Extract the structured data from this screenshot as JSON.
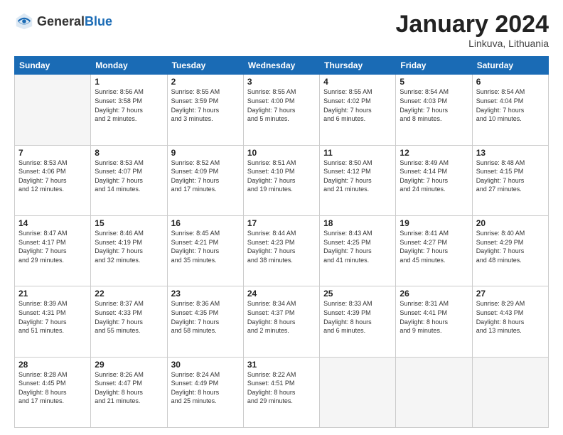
{
  "header": {
    "logo_general": "General",
    "logo_blue": "Blue",
    "month_title": "January 2024",
    "subtitle": "Linkuva, Lithuania"
  },
  "days_of_week": [
    "Sunday",
    "Monday",
    "Tuesday",
    "Wednesday",
    "Thursday",
    "Friday",
    "Saturday"
  ],
  "weeks": [
    [
      {
        "day": "",
        "info": ""
      },
      {
        "day": "1",
        "info": "Sunrise: 8:56 AM\nSunset: 3:58 PM\nDaylight: 7 hours\nand 2 minutes."
      },
      {
        "day": "2",
        "info": "Sunrise: 8:55 AM\nSunset: 3:59 PM\nDaylight: 7 hours\nand 3 minutes."
      },
      {
        "day": "3",
        "info": "Sunrise: 8:55 AM\nSunset: 4:00 PM\nDaylight: 7 hours\nand 5 minutes."
      },
      {
        "day": "4",
        "info": "Sunrise: 8:55 AM\nSunset: 4:02 PM\nDaylight: 7 hours\nand 6 minutes."
      },
      {
        "day": "5",
        "info": "Sunrise: 8:54 AM\nSunset: 4:03 PM\nDaylight: 7 hours\nand 8 minutes."
      },
      {
        "day": "6",
        "info": "Sunrise: 8:54 AM\nSunset: 4:04 PM\nDaylight: 7 hours\nand 10 minutes."
      }
    ],
    [
      {
        "day": "7",
        "info": "Sunrise: 8:53 AM\nSunset: 4:06 PM\nDaylight: 7 hours\nand 12 minutes."
      },
      {
        "day": "8",
        "info": "Sunrise: 8:53 AM\nSunset: 4:07 PM\nDaylight: 7 hours\nand 14 minutes."
      },
      {
        "day": "9",
        "info": "Sunrise: 8:52 AM\nSunset: 4:09 PM\nDaylight: 7 hours\nand 17 minutes."
      },
      {
        "day": "10",
        "info": "Sunrise: 8:51 AM\nSunset: 4:10 PM\nDaylight: 7 hours\nand 19 minutes."
      },
      {
        "day": "11",
        "info": "Sunrise: 8:50 AM\nSunset: 4:12 PM\nDaylight: 7 hours\nand 21 minutes."
      },
      {
        "day": "12",
        "info": "Sunrise: 8:49 AM\nSunset: 4:14 PM\nDaylight: 7 hours\nand 24 minutes."
      },
      {
        "day": "13",
        "info": "Sunrise: 8:48 AM\nSunset: 4:15 PM\nDaylight: 7 hours\nand 27 minutes."
      }
    ],
    [
      {
        "day": "14",
        "info": "Sunrise: 8:47 AM\nSunset: 4:17 PM\nDaylight: 7 hours\nand 29 minutes."
      },
      {
        "day": "15",
        "info": "Sunrise: 8:46 AM\nSunset: 4:19 PM\nDaylight: 7 hours\nand 32 minutes."
      },
      {
        "day": "16",
        "info": "Sunrise: 8:45 AM\nSunset: 4:21 PM\nDaylight: 7 hours\nand 35 minutes."
      },
      {
        "day": "17",
        "info": "Sunrise: 8:44 AM\nSunset: 4:23 PM\nDaylight: 7 hours\nand 38 minutes."
      },
      {
        "day": "18",
        "info": "Sunrise: 8:43 AM\nSunset: 4:25 PM\nDaylight: 7 hours\nand 41 minutes."
      },
      {
        "day": "19",
        "info": "Sunrise: 8:41 AM\nSunset: 4:27 PM\nDaylight: 7 hours\nand 45 minutes."
      },
      {
        "day": "20",
        "info": "Sunrise: 8:40 AM\nSunset: 4:29 PM\nDaylight: 7 hours\nand 48 minutes."
      }
    ],
    [
      {
        "day": "21",
        "info": "Sunrise: 8:39 AM\nSunset: 4:31 PM\nDaylight: 7 hours\nand 51 minutes."
      },
      {
        "day": "22",
        "info": "Sunrise: 8:37 AM\nSunset: 4:33 PM\nDaylight: 7 hours\nand 55 minutes."
      },
      {
        "day": "23",
        "info": "Sunrise: 8:36 AM\nSunset: 4:35 PM\nDaylight: 7 hours\nand 58 minutes."
      },
      {
        "day": "24",
        "info": "Sunrise: 8:34 AM\nSunset: 4:37 PM\nDaylight: 8 hours\nand 2 minutes."
      },
      {
        "day": "25",
        "info": "Sunrise: 8:33 AM\nSunset: 4:39 PM\nDaylight: 8 hours\nand 6 minutes."
      },
      {
        "day": "26",
        "info": "Sunrise: 8:31 AM\nSunset: 4:41 PM\nDaylight: 8 hours\nand 9 minutes."
      },
      {
        "day": "27",
        "info": "Sunrise: 8:29 AM\nSunset: 4:43 PM\nDaylight: 8 hours\nand 13 minutes."
      }
    ],
    [
      {
        "day": "28",
        "info": "Sunrise: 8:28 AM\nSunset: 4:45 PM\nDaylight: 8 hours\nand 17 minutes."
      },
      {
        "day": "29",
        "info": "Sunrise: 8:26 AM\nSunset: 4:47 PM\nDaylight: 8 hours\nand 21 minutes."
      },
      {
        "day": "30",
        "info": "Sunrise: 8:24 AM\nSunset: 4:49 PM\nDaylight: 8 hours\nand 25 minutes."
      },
      {
        "day": "31",
        "info": "Sunrise: 8:22 AM\nSunset: 4:51 PM\nDaylight: 8 hours\nand 29 minutes."
      },
      {
        "day": "",
        "info": ""
      },
      {
        "day": "",
        "info": ""
      },
      {
        "day": "",
        "info": ""
      }
    ]
  ]
}
